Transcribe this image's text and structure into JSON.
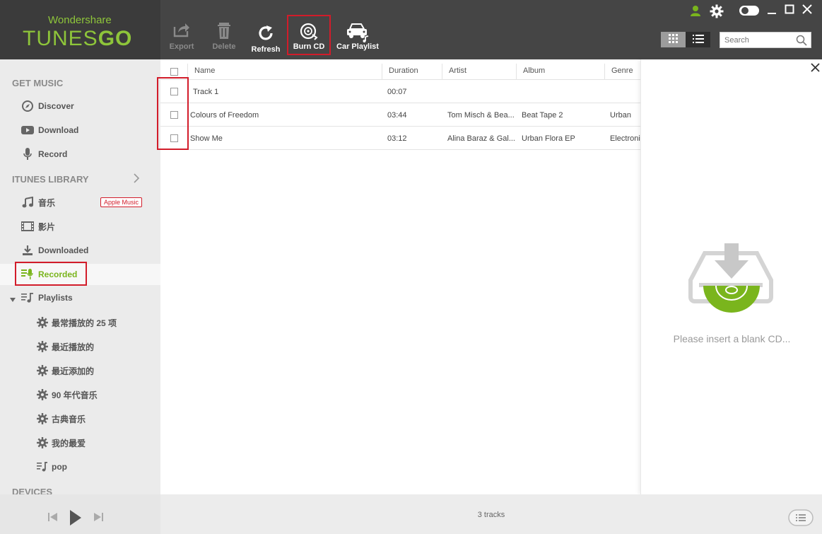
{
  "app": {
    "brand_top": "Wondershare",
    "brand_main_a": "TUNES",
    "brand_main_b": "GO"
  },
  "toolbar": {
    "export_label": "Export",
    "delete_label": "Delete",
    "refresh_label": "Refresh",
    "burncd_label": "Burn CD",
    "carplaylist_label": "Car Playlist"
  },
  "search": {
    "placeholder": "Search"
  },
  "sidebar": {
    "get_music_header": "GET MUSIC",
    "get_music": [
      "Discover",
      "Download",
      "Record"
    ],
    "itunes_header": "ITUNES LIBRARY",
    "itunes_items": [
      "音乐",
      "影片",
      "Downloaded",
      "Recorded"
    ],
    "apple_music_badge": "Apple Music",
    "playlists_label": "Playlists",
    "playlists": [
      "最常播放的 25 项",
      "最近播放的",
      "最近添加的",
      "90 年代音乐",
      "古典音乐",
      "我的最爱",
      "pop"
    ],
    "devices_header": "DEVICES"
  },
  "table": {
    "columns": [
      "Name",
      "Duration",
      "Artist",
      "Album",
      "Genre"
    ],
    "rows": [
      {
        "name": "Track 1",
        "duration": "00:07",
        "artist": "",
        "album": "",
        "genre": ""
      },
      {
        "name": "Colours of Freedom",
        "duration": "03:44",
        "artist": "Tom Misch & Bea...",
        "album": "Beat Tape 2",
        "genre": "Urban"
      },
      {
        "name": "Show Me",
        "duration": "03:12",
        "artist": "Alina Baraz & Gal...",
        "album": "Urban Flora EP",
        "genre": "Electronic"
      }
    ]
  },
  "panel": {
    "insert_cd_text": "Please insert a blank CD..."
  },
  "status": {
    "tracks_count": "3 tracks"
  },
  "colors": {
    "accent": "#7ab51d",
    "highlight_box": "#d21c2a",
    "topbar": "#454545"
  }
}
